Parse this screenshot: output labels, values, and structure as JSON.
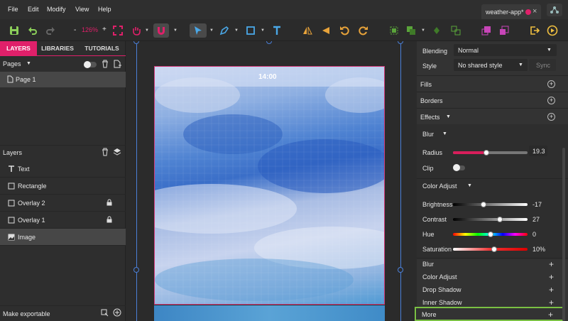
{
  "menubar": {
    "items": [
      "File",
      "Edit",
      "Modify",
      "View",
      "Help"
    ],
    "tab_title": "weather-app*",
    "tab_close": "×"
  },
  "toolbar": {
    "zoom_minus": "-",
    "zoom_value": "126%",
    "zoom_plus": "+"
  },
  "left_panel": {
    "tabs": [
      "LAYERS",
      "LIBRARIES",
      "TUTORIALS"
    ],
    "pages_label": "Pages",
    "pages": [
      "Page 1"
    ],
    "layers_label": "Layers",
    "layers": [
      {
        "name": "Text",
        "icon": "text-icon",
        "locked": false
      },
      {
        "name": "Rectangle",
        "icon": "rectangle-icon",
        "locked": false
      },
      {
        "name": "Overlay 2",
        "icon": "rectangle-icon",
        "locked": true
      },
      {
        "name": "Overlay 1",
        "icon": "rectangle-icon",
        "locked": true
      },
      {
        "name": "Image",
        "icon": "image-icon",
        "locked": false
      }
    ],
    "make_exportable": "Make exportable"
  },
  "canvas": {
    "time": "14:00"
  },
  "right_panel": {
    "blending_label": "Blending",
    "blending_value": "Normal",
    "style_label": "Style",
    "style_value": "No shared style",
    "sync_label": "Sync",
    "fills_label": "Fills",
    "borders_label": "Borders",
    "effects_label": "Effects",
    "blur_label": "Blur",
    "radius_label": "Radius",
    "radius_value": "19.3",
    "radius_level": 0.45,
    "clip_label": "Clip",
    "color_adjust_label": "Color Adjust",
    "brightness_label": "Brightness",
    "brightness_value": "-17",
    "brightness_level": 0.41,
    "contrast_label": "Contrast",
    "contrast_value": "27",
    "contrast_level": 0.63,
    "hue_label": "Hue",
    "hue_value": "0",
    "hue_level": 0.5,
    "saturation_label": "Saturation",
    "saturation_value": "10%",
    "saturation_level": 0.55,
    "add_items": [
      "Blur",
      "Color Adjust",
      "Drop Shadow",
      "Inner Shadow",
      "More"
    ]
  },
  "colors": {
    "accent": "#e0206a",
    "highlight": "#7ac043",
    "selection": "#4a7fd8"
  }
}
